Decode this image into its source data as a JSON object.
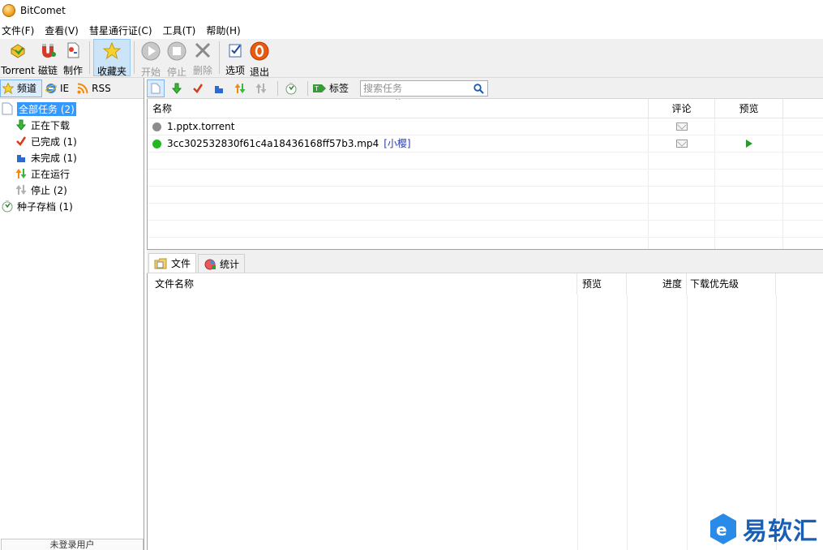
{
  "window": {
    "title": "BitComet"
  },
  "menu": [
    "文件(F)",
    "查看(V)",
    "彗星通行证(C)",
    "工具(T)",
    "帮助(H)"
  ],
  "toolbar": {
    "torrent": "Torrent",
    "magnet": "磁链",
    "make": "制作",
    "favorites": "收藏夹",
    "start": "开始",
    "stop": "停止",
    "delete": "删除",
    "options": "选项",
    "exit": "退出"
  },
  "channels": {
    "tab_channel": "频道",
    "tab_ie": "IE",
    "tab_rss": "RSS"
  },
  "tree": {
    "all_tasks": "全部任务 (2)",
    "downloading": "正在下载",
    "completed": "已完成 (1)",
    "incomplete": "未完成 (1)",
    "running": "正在运行",
    "stopped": "停止 (2)",
    "torrent_archive": "种子存档 (1)"
  },
  "login_box": "未登录用户",
  "task_toolbar": {
    "tag_label": "标签",
    "search_placeholder": "搜索任务"
  },
  "task_list": {
    "columns": {
      "name": "名称",
      "comment": "评论",
      "preview": "预览"
    },
    "rows": [
      {
        "name": "1.pptx.torrent",
        "status_color": "#8c8c8c",
        "tag": "",
        "has_preview": false
      },
      {
        "name": "3cc302532830f61c4a18436168ff57b3.mp4",
        "status_color": "#22b822",
        "tag": "[小樱]",
        "has_preview": true
      }
    ]
  },
  "detail_tabs": {
    "files": "文件",
    "stats": "统计"
  },
  "file_list": {
    "columns": {
      "name": "文件名称",
      "preview": "预览",
      "progress": "进度",
      "priority": "下载优先级"
    }
  },
  "watermark": {
    "text": "易软汇"
  }
}
